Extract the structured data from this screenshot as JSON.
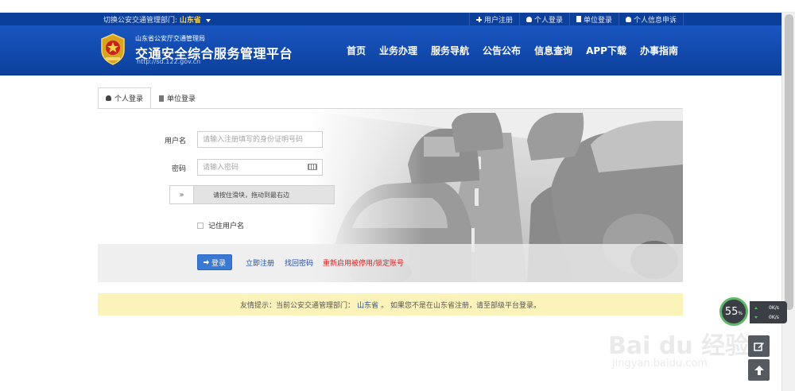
{
  "topbar": {
    "dept_prefix": "切换公安交通管理部门:",
    "province": "山东省",
    "links": [
      {
        "label": "用户注册",
        "icon": "plus-icon"
      },
      {
        "label": "个人登录",
        "icon": "user-icon"
      },
      {
        "label": "单位登录",
        "icon": "building-icon"
      },
      {
        "label": "个人信息申诉",
        "icon": "user-icon"
      }
    ]
  },
  "header": {
    "subtitle": "山东省公安厅交通管理局",
    "title": "交通安全综合服务管理平台",
    "site": "http://sd.122.gov.cn",
    "nav": [
      "首页",
      "业务办理",
      "服务导航",
      "公告公布",
      "信息查询",
      "APP下载",
      "办事指南"
    ]
  },
  "tabs": [
    {
      "label": "个人登录",
      "icon": "user-icon",
      "active": true
    },
    {
      "label": "单位登录",
      "icon": "building-icon",
      "active": false
    }
  ],
  "login": {
    "username_label": "用户名",
    "username_placeholder": "请输入注册填写的身份证明号码",
    "password_label": "密码",
    "password_placeholder": "请输入密码",
    "slider_handle": "»",
    "slider_text": "请按住滑块，拖动到最右边",
    "remember_label": "记住用户名",
    "login_button": "登录",
    "register_link": "立即注册",
    "recover_link": "找回密码",
    "reactivate_link": "重新启用被停用/锁定账号"
  },
  "notice": {
    "prefix": "友情提示：当前公安交通管理部门：",
    "province": "山东省",
    "suffix": "。 如果您不是在山东省注册，请至部级平台登录。"
  },
  "speed_widget": {
    "percent": "55",
    "percent_unit": "%",
    "upload": "0K/s",
    "download": "0K/s"
  },
  "watermark": {
    "brand": "Bai du 经验",
    "url": "jingyan.baidu.com"
  },
  "colors": {
    "topbar": "#0b3f9a",
    "header": "#1a56c2",
    "accent_link": "#1f4fa8",
    "danger_link": "#e02020",
    "login_button": "#3a78d6",
    "notice_bg": "#fbf3b9"
  }
}
